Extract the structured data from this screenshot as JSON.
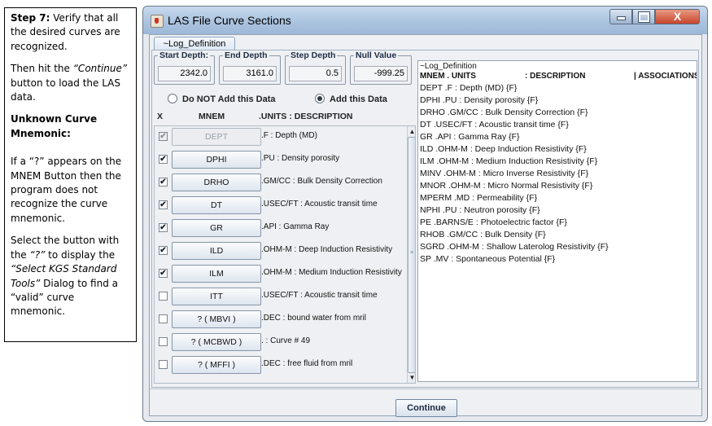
{
  "instructions": {
    "step_label": "Step 7:",
    "step_text": " Verify that all the desired curves are recognized.",
    "continue_pre": "Then hit the ",
    "continue_word": "“Continue”",
    "continue_post": " button to load the LAS data.",
    "unknown_heading": "Unknown Curve Mnemonic:",
    "unknown_text": "If a “?”  appears on the MNEM Button then the program does not recognize the curve mnemonic.",
    "select_pre": "Select the button with the ",
    "select_q": "“?”",
    "select_mid": " to display the ",
    "select_dialog": "“Select KGS Standard Tools”",
    "select_post": " Dialog to find a “valid” curve mnemonic."
  },
  "window": {
    "title": "LAS File Curve Sections",
    "min_symbol": "",
    "close_symbol": "X"
  },
  "tab": {
    "label": "~Log_Definition"
  },
  "fields": {
    "start_depth": {
      "label": "Start Depth:",
      "value": "2342.0"
    },
    "end_depth": {
      "label": "End Depth",
      "value": "3161.0"
    },
    "step_depth": {
      "label": "Step Depth",
      "value": "0.5"
    },
    "null_value": {
      "label": "Null Value",
      "value": "-999.25"
    }
  },
  "radio": {
    "do_not_add": "Do NOT Add this Data",
    "add": "Add this Data",
    "selected": "add"
  },
  "columns": {
    "x": "X",
    "mnem": "MNEM",
    "units_desc": ".UNITS  : DESCRIPTION"
  },
  "curves": [
    {
      "checked": true,
      "disabled": true,
      "mnem": "DEPT",
      "desc": ".F : Depth (MD)"
    },
    {
      "checked": true,
      "disabled": false,
      "mnem": "DPHI",
      "desc": ".PU : Density porosity"
    },
    {
      "checked": true,
      "disabled": false,
      "mnem": "DRHO",
      "desc": ".GM/CC : Bulk Density Correction"
    },
    {
      "checked": true,
      "disabled": false,
      "mnem": "DT",
      "desc": ".USEC/FT : Acoustic transit time"
    },
    {
      "checked": true,
      "disabled": false,
      "mnem": "GR",
      "desc": ".API : Gamma Ray"
    },
    {
      "checked": true,
      "disabled": false,
      "mnem": "ILD",
      "desc": ".OHM-M : Deep Induction Resistivity"
    },
    {
      "checked": true,
      "disabled": false,
      "mnem": "ILM",
      "desc": ".OHM-M : Medium Induction Resistivity"
    },
    {
      "checked": false,
      "disabled": false,
      "mnem": "ITT",
      "desc": ".USEC/FT : Acoustic transit time"
    },
    {
      "checked": false,
      "disabled": false,
      "mnem": "? ( MBVI )",
      "desc": ".DEC : bound water from mril"
    },
    {
      "checked": false,
      "disabled": false,
      "mnem": "? ( MCBWD )",
      "desc": ". : Curve #  49"
    },
    {
      "checked": false,
      "disabled": false,
      "mnem": "? ( MFFI )",
      "desc": ".DEC : free fluid from mril"
    }
  ],
  "scroll": {
    "up": "▲",
    "down": "▼",
    "grip": "≡"
  },
  "log_text": {
    "title": "~Log_Definition",
    "header_mnem": "MNEM . UNITS",
    "header_desc": ": DESCRIPTION",
    "header_assoc": "| ASSOCIATIONS",
    "lines": [
      "DEPT .F     : Depth (MD)  {F}",
      "DPHI .PU     : Density porosity  {F}",
      "DRHO .GM/CC     : Bulk Density Correction  {F}",
      "DT .USEC/FT     : Acoustic transit time  {F}",
      "GR .API     : Gamma Ray  {F}",
      "ILD .OHM-M     : Deep Induction Resistivity  {F}",
      "ILM .OHM-M     : Medium Induction Resistivity  {F}",
      "MINV .OHM-M     : Micro Inverse Resistivity  {F}",
      "MNOR .OHM-M     : Micro Normal Resistivity  {F}",
      "MPERM .MD     : Permeability  {F}",
      "NPHI .PU     : Neutron porosity  {F}",
      "PE .BARNS/E     : Photoelectric factor  {F}",
      "RHOB .GM/CC     : Bulk Density  {F}",
      "SGRD .OHM-M     : Shallow Laterolog Resistivity  {F}",
      "SP .MV     : Spontaneous Potential  {F}"
    ]
  },
  "continue_label": "Continue"
}
